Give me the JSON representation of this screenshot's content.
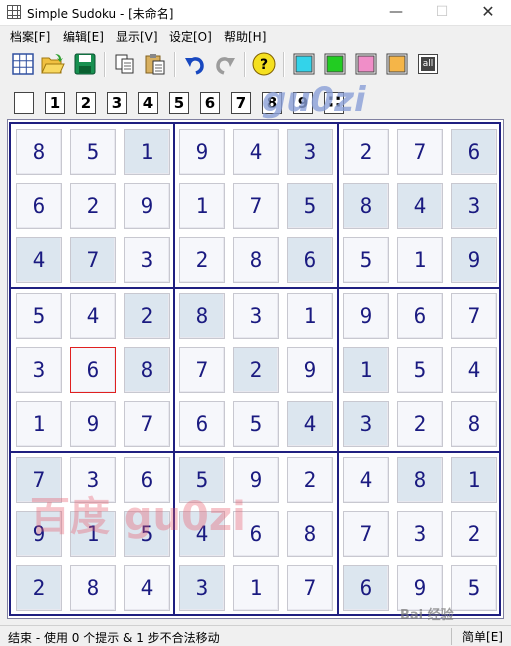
{
  "window": {
    "title": "Simple Sudoku - [未命名]"
  },
  "menu": [
    {
      "label": "档案[F]"
    },
    {
      "label": "编辑[E]"
    },
    {
      "label": "显示[V]"
    },
    {
      "label": "设定[O]"
    },
    {
      "label": "帮助[H]"
    }
  ],
  "toolbar": {
    "all_label": "all",
    "colors": [
      "#33d3ea",
      "#22cc22",
      "#f08ec8",
      "#f5b548"
    ]
  },
  "digits": [
    "1",
    "2",
    "3",
    "4",
    "5",
    "6",
    "7",
    "8",
    "9"
  ],
  "board": {
    "selected": [
      4,
      1
    ],
    "rows": [
      [
        "8",
        "5",
        "1",
        "9",
        "4",
        "3",
        "2",
        "7",
        "6"
      ],
      [
        "6",
        "2",
        "9",
        "1",
        "7",
        "5",
        "8",
        "4",
        "3"
      ],
      [
        "4",
        "7",
        "3",
        "2",
        "8",
        "6",
        "5",
        "1",
        "9"
      ],
      [
        "5",
        "4",
        "2",
        "8",
        "3",
        "1",
        "9",
        "6",
        "7"
      ],
      [
        "3",
        "6",
        "8",
        "7",
        "2",
        "9",
        "1",
        "5",
        "4"
      ],
      [
        "1",
        "9",
        "7",
        "6",
        "5",
        "4",
        "3",
        "2",
        "8"
      ],
      [
        "7",
        "3",
        "6",
        "5",
        "9",
        "2",
        "4",
        "8",
        "1"
      ],
      [
        "9",
        "1",
        "5",
        "4",
        "6",
        "8",
        "7",
        "3",
        "2"
      ],
      [
        "2",
        "8",
        "4",
        "3",
        "1",
        "7",
        "6",
        "9",
        "5"
      ]
    ],
    "given": [
      [
        0,
        0,
        1,
        0,
        0,
        1,
        0,
        0,
        1
      ],
      [
        0,
        0,
        0,
        0,
        0,
        1,
        1,
        1,
        1
      ],
      [
        1,
        1,
        0,
        0,
        0,
        1,
        0,
        0,
        1
      ],
      [
        0,
        0,
        1,
        1,
        0,
        0,
        0,
        0,
        0
      ],
      [
        0,
        0,
        1,
        0,
        1,
        0,
        1,
        0,
        0
      ],
      [
        0,
        0,
        0,
        0,
        0,
        1,
        1,
        0,
        0
      ],
      [
        1,
        0,
        0,
        1,
        0,
        0,
        0,
        1,
        1
      ],
      [
        1,
        1,
        1,
        1,
        0,
        0,
        0,
        0,
        0
      ],
      [
        1,
        0,
        0,
        1,
        0,
        0,
        1,
        0,
        0
      ]
    ]
  },
  "status": {
    "text": "结束 - 使用 0 个提示 & 1 步不合法移动",
    "mode": "简单[E]"
  },
  "watermarks": {
    "top": "gu0zi",
    "middle": "百度 gu0zi",
    "bottom": "Bai 经验"
  }
}
